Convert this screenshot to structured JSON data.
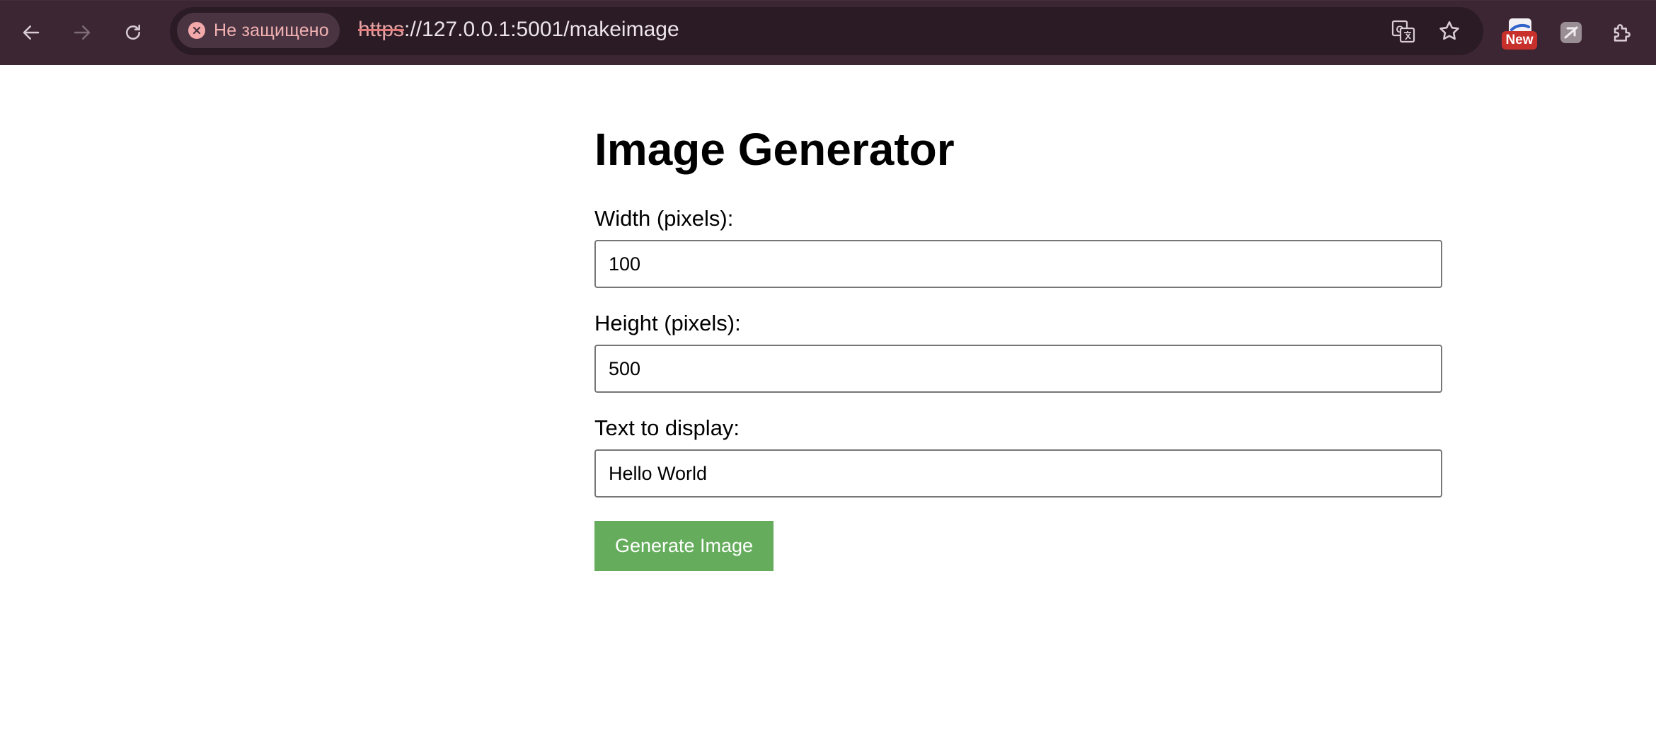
{
  "browser": {
    "security_label": "Не защищено",
    "url_scheme": "https",
    "url_rest": "://127.0.0.1:5001/makeimage",
    "extension_badge": "New",
    "icons": {
      "back": "back-arrow-icon",
      "forward": "forward-arrow-icon",
      "reload": "reload-icon",
      "not_secure": "not-secure-icon",
      "translate": "translate-icon",
      "bookmark": "bookmark-star-icon",
      "extension_new": "extension-new-icon",
      "extension_2": "extension-icon",
      "extensions_menu": "puzzle-icon"
    },
    "colors": {
      "toolbar": "#3d2634",
      "omnibox": "#2a1b25",
      "badge": "#c8302c"
    }
  },
  "page": {
    "title": "Image Generator",
    "fields": [
      {
        "label": "Width (pixels):",
        "value": "100"
      },
      {
        "label": "Height (pixels):",
        "value": "500"
      },
      {
        "label": "Text to display:",
        "value": "Hello World"
      }
    ],
    "submit_label": "Generate Image",
    "colors": {
      "button": "#65ad5c"
    }
  }
}
